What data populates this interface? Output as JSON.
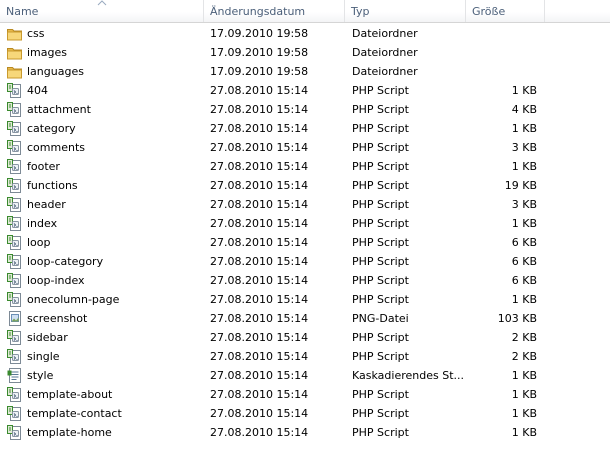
{
  "columns": {
    "name": "Name",
    "date": "Änderungsdatum",
    "type": "Typ",
    "size": "Größe"
  },
  "colors": {
    "header_text": "#4c607a",
    "folder": "#e8b94a",
    "php_icon": "#3a8a2e"
  },
  "files": [
    {
      "name": "css",
      "date": "17.09.2010 19:58",
      "type": "Dateiordner",
      "size": "",
      "icon": "folder-icon"
    },
    {
      "name": "images",
      "date": "17.09.2010 19:58",
      "type": "Dateiordner",
      "size": "",
      "icon": "folder-icon"
    },
    {
      "name": "languages",
      "date": "17.09.2010 19:58",
      "type": "Dateiordner",
      "size": "",
      "icon": "folder-icon"
    },
    {
      "name": "404",
      "date": "27.08.2010 15:14",
      "type": "PHP Script",
      "size": "1 KB",
      "icon": "php-file-icon"
    },
    {
      "name": "attachment",
      "date": "27.08.2010 15:14",
      "type": "PHP Script",
      "size": "4 KB",
      "icon": "php-file-icon"
    },
    {
      "name": "category",
      "date": "27.08.2010 15:14",
      "type": "PHP Script",
      "size": "1 KB",
      "icon": "php-file-icon"
    },
    {
      "name": "comments",
      "date": "27.08.2010 15:14",
      "type": "PHP Script",
      "size": "3 KB",
      "icon": "php-file-icon"
    },
    {
      "name": "footer",
      "date": "27.08.2010 15:14",
      "type": "PHP Script",
      "size": "1 KB",
      "icon": "php-file-icon"
    },
    {
      "name": "functions",
      "date": "27.08.2010 15:14",
      "type": "PHP Script",
      "size": "19 KB",
      "icon": "php-file-icon"
    },
    {
      "name": "header",
      "date": "27.08.2010 15:14",
      "type": "PHP Script",
      "size": "3 KB",
      "icon": "php-file-icon"
    },
    {
      "name": "index",
      "date": "27.08.2010 15:14",
      "type": "PHP Script",
      "size": "1 KB",
      "icon": "php-file-icon"
    },
    {
      "name": "loop",
      "date": "27.08.2010 15:14",
      "type": "PHP Script",
      "size": "6 KB",
      "icon": "php-file-icon"
    },
    {
      "name": "loop-category",
      "date": "27.08.2010 15:14",
      "type": "PHP Script",
      "size": "6 KB",
      "icon": "php-file-icon"
    },
    {
      "name": "loop-index",
      "date": "27.08.2010 15:14",
      "type": "PHP Script",
      "size": "6 KB",
      "icon": "php-file-icon"
    },
    {
      "name": "onecolumn-page",
      "date": "27.08.2010 15:14",
      "type": "PHP Script",
      "size": "1 KB",
      "icon": "php-file-icon"
    },
    {
      "name": "screenshot",
      "date": "27.08.2010 15:14",
      "type": "PNG-Datei",
      "size": "103 KB",
      "icon": "png-file-icon"
    },
    {
      "name": "sidebar",
      "date": "27.08.2010 15:14",
      "type": "PHP Script",
      "size": "2 KB",
      "icon": "php-file-icon"
    },
    {
      "name": "single",
      "date": "27.08.2010 15:14",
      "type": "PHP Script",
      "size": "2 KB",
      "icon": "php-file-icon"
    },
    {
      "name": "style",
      "date": "27.08.2010 15:14",
      "type": "Kaskadierendes St...",
      "size": "1 KB",
      "icon": "css-file-icon"
    },
    {
      "name": "template-about",
      "date": "27.08.2010 15:14",
      "type": "PHP Script",
      "size": "1 KB",
      "icon": "php-file-icon"
    },
    {
      "name": "template-contact",
      "date": "27.08.2010 15:14",
      "type": "PHP Script",
      "size": "1 KB",
      "icon": "php-file-icon"
    },
    {
      "name": "template-home",
      "date": "27.08.2010 15:14",
      "type": "PHP Script",
      "size": "1 KB",
      "icon": "php-file-icon"
    }
  ]
}
